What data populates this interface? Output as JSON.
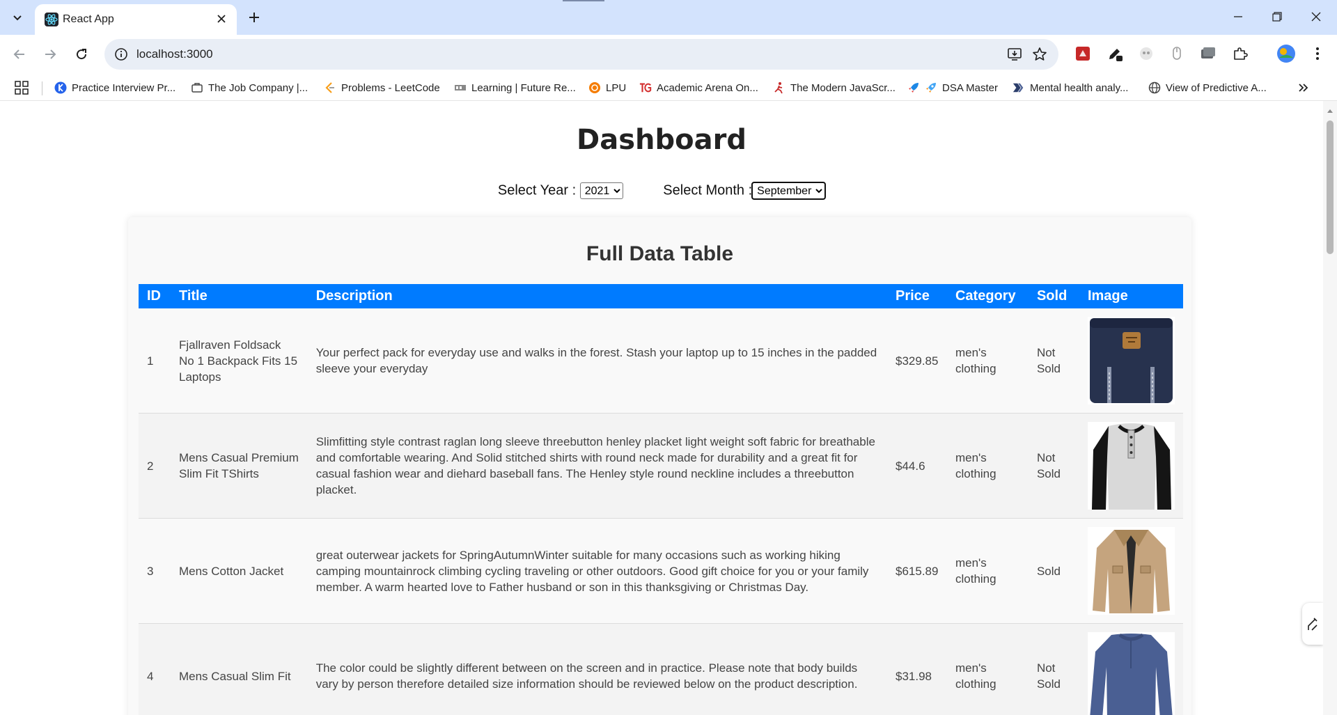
{
  "browser": {
    "tab_title": "React App",
    "url": "localhost:3000",
    "bookmarks": [
      "Practice Interview Pr...",
      "The Job Company |...",
      "Problems - LeetCode",
      "Learning | Future Re...",
      "LPU",
      "Academic Arena On...",
      "The Modern JavaScr...",
      "DSA Master",
      "Mental health analy...",
      "View of Predictive A..."
    ]
  },
  "page": {
    "title": "Dashboard",
    "year_label": "Select Year :",
    "year_value": "2021",
    "month_label": "Select Month :",
    "month_value": "September",
    "table_title": "Full Data Table",
    "columns": [
      "ID",
      "Title",
      "Description",
      "Price",
      "Category",
      "Sold",
      "Image"
    ],
    "rows": [
      {
        "id": "1",
        "title": "Fjallraven Foldsack No 1 Backpack Fits 15 Laptops",
        "description": "Your perfect pack for everyday use and walks in the forest. Stash your laptop up to 15 inches in the padded sleeve your everyday",
        "price": "$329.85",
        "category": "men's clothing",
        "sold": "Not Sold",
        "image_icon": "backpack-icon"
      },
      {
        "id": "2",
        "title": "Mens Casual Premium Slim Fit TShirts",
        "description": "Slimfitting style contrast raglan long sleeve threebutton henley placket light weight soft fabric for breathable and comfortable wearing. And Solid stitched shirts with round neck made for durability and a great fit for casual fashion wear and diehard baseball fans. The Henley style round neckline includes a threebutton placket.",
        "price": "$44.6",
        "category": "men's clothing",
        "sold": "Not Sold",
        "image_icon": "tshirt-icon"
      },
      {
        "id": "3",
        "title": "Mens Cotton Jacket",
        "description": "great outerwear jackets for SpringAutumnWinter suitable for many occasions such as working hiking camping mountainrock climbing cycling traveling or other outdoors. Good gift choice for you or your family member. A warm hearted love to Father husband or son in this thanksgiving or Christmas Day.",
        "price": "$615.89",
        "category": "men's clothing",
        "sold": "Sold",
        "image_icon": "jacket-icon"
      },
      {
        "id": "4",
        "title": "Mens Casual Slim Fit",
        "description": "The color could be slightly different between on the screen and in practice. Please note that body builds vary by person therefore detailed size information should be reviewed below on the product description.",
        "price": "$31.98",
        "category": "men's clothing",
        "sold": "Not Sold",
        "image_icon": "longsleeve-icon"
      }
    ]
  },
  "colors": {
    "header_blue": "#007bff",
    "tabstrip": "#d3e3fd"
  }
}
